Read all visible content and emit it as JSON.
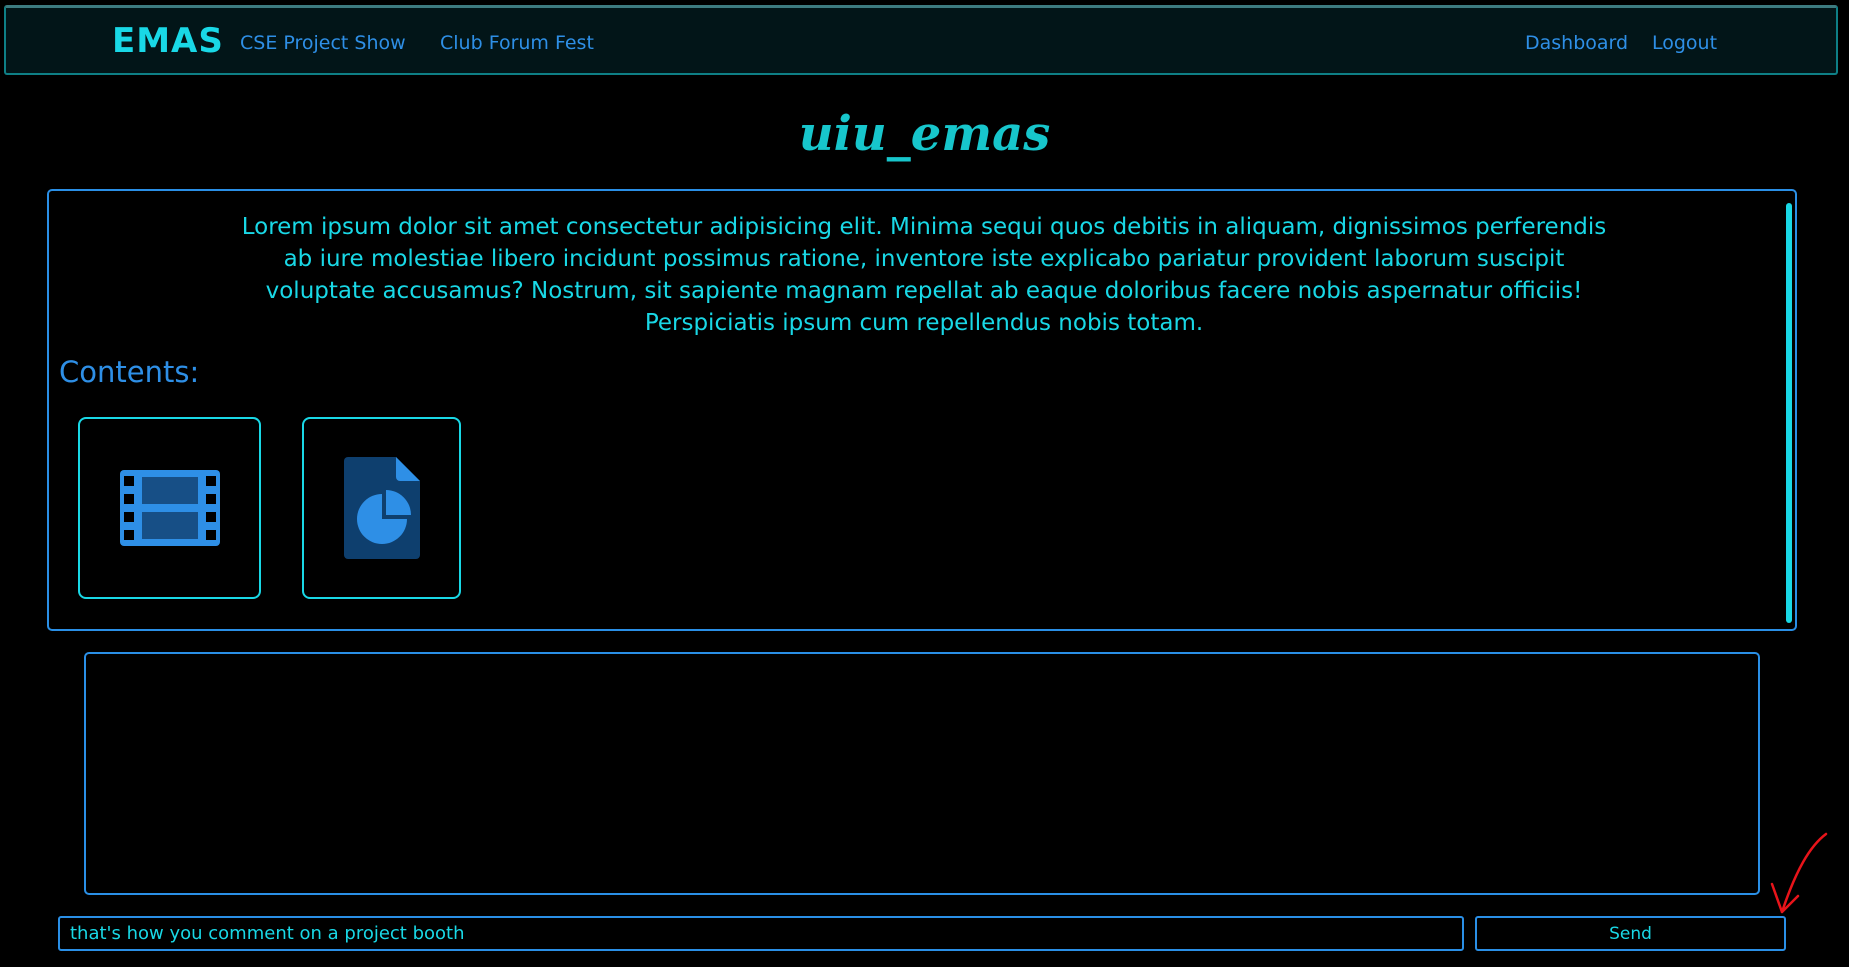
{
  "navbar": {
    "brand": "EMAS",
    "links": [
      {
        "label": "CSE Project Show"
      },
      {
        "label": "Club Forum Fest"
      }
    ],
    "right_links": [
      {
        "label": "Dashboard"
      },
      {
        "label": "Logout"
      }
    ]
  },
  "page": {
    "title": "uiu_emas"
  },
  "content": {
    "description": "Lorem ipsum dolor sit amet consectetur adipisicing elit. Minima sequi quos debitis in aliquam, dignissimos perferendis ab iure molestiae libero incidunt possimus ratione, inventore iste explicabo pariatur provident laborum suscipit voluptate accusamus? Nostrum, sit sapiente magnam repellat ab eaque doloribus facere nobis aspernatur officiis! Perspiciatis ipsum cum repellendus nobis totam.",
    "heading": "Contents:",
    "items": [
      {
        "icon": "film-icon"
      },
      {
        "icon": "pie-chart-document-icon"
      }
    ]
  },
  "comment": {
    "input_value": "that's how you comment on a project booth",
    "send_label": "Send"
  },
  "colors": {
    "accent_cyan": "#19d8e6",
    "accent_blue": "#2e8fe6",
    "background": "#000000",
    "annotation_red": "#e8141a"
  }
}
